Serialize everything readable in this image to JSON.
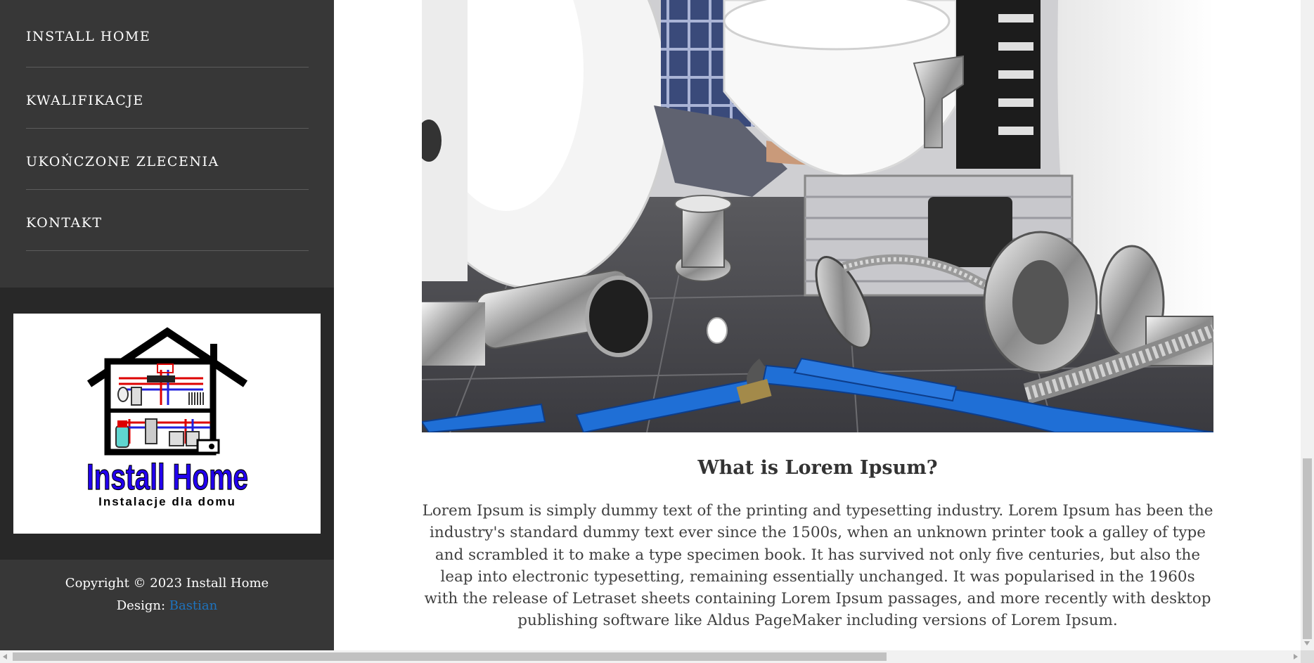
{
  "sidebar": {
    "nav": [
      {
        "label": "INSTALL HOME"
      },
      {
        "label": "KWALIFIKACJE"
      },
      {
        "label": "UKOŃCZONE ZLECENIA"
      },
      {
        "label": "KONTAKT"
      }
    ],
    "logo": {
      "title": "Install Home",
      "subtitle": "Instalacje dla domu"
    },
    "footer": {
      "copyright": "Copyright © 2023 Install Home",
      "design_label": "Design: ",
      "design_link": "Bastian"
    }
  },
  "article": {
    "hero_alt": "plumber-installing-toilet",
    "title": "What is Lorem Ipsum?",
    "body": "Lorem Ipsum is simply dummy text of the printing and typesetting industry. Lorem Ipsum has been the industry's standard dummy text ever since the 1500s, when an unknown printer took a galley of type and scrambled it to make a type specimen book. It has survived not only five centuries, but also the leap into electronic typesetting, remaining essentially unchanged. It was popularised in the 1960s with the release of Letraset sheets containing Lorem Ipsum passages, and more recently with desktop publishing software like Aldus PageMaker including versions of Lorem Ipsum."
  },
  "colors": {
    "sidebar_bg": "#373737",
    "logo_band_bg": "#282828",
    "link": "#1e73be",
    "logo_blue": "#2200ee"
  }
}
